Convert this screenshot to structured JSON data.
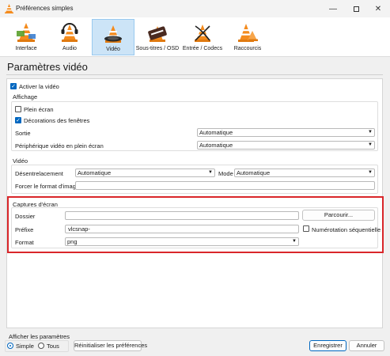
{
  "window": {
    "title": "Préférences simples"
  },
  "toolbar": {
    "items": [
      {
        "label": "Interface",
        "icon": "interface-icon"
      },
      {
        "label": "Audio",
        "icon": "audio-icon"
      },
      {
        "label": "Vidéo",
        "icon": "video-icon",
        "selected": true
      },
      {
        "label": "Sous-titres / OSD",
        "icon": "subtitles-icon"
      },
      {
        "label": "Entrée / Codecs",
        "icon": "codecs-icon"
      },
      {
        "label": "Raccourcis",
        "icon": "shortcuts-icon"
      }
    ]
  },
  "page": {
    "heading": "Paramètres vidéo"
  },
  "enable_video": {
    "label": "Activer la vidéo",
    "checked": true
  },
  "display": {
    "title": "Affichage",
    "fullscreen": {
      "label": "Plein écran",
      "checked": false
    },
    "decorations": {
      "label": "Décorations des fenêtres",
      "checked": true
    },
    "output": {
      "label": "Sortie",
      "value": "Automatique"
    },
    "fs_device": {
      "label": "Périphérique vidéo en plein écran",
      "value": "Automatique"
    }
  },
  "video": {
    "title": "Vidéo",
    "deinterlace": {
      "label": "Désentrelacement",
      "value": "Automatique"
    },
    "mode": {
      "label": "Mode",
      "value": "Automatique"
    },
    "force_format": {
      "label": "Forcer le format d'image",
      "value": ""
    }
  },
  "snapshots": {
    "title": "Captures d'écran",
    "folder": {
      "label": "Dossier",
      "value": ""
    },
    "browse_label": "Parcourir...",
    "prefix": {
      "label": "Préfixe",
      "value": "vlcsnap-"
    },
    "sequential": {
      "label": "Numérotation séquentielle",
      "checked": false
    },
    "format": {
      "label": "Format",
      "value": "png"
    },
    "highlight_color": "#d9262a"
  },
  "footer": {
    "show_settings": "Afficher les paramètres",
    "simple": "Simple",
    "all": "Tous",
    "selected_mode": "simple",
    "reset": "Réinitialiser les préférences",
    "save": "Enregistrer",
    "cancel": "Annuler"
  },
  "colors": {
    "accent": "#0067c0",
    "vlc_orange": "#f48b1d",
    "selection": "#cce4f7"
  }
}
